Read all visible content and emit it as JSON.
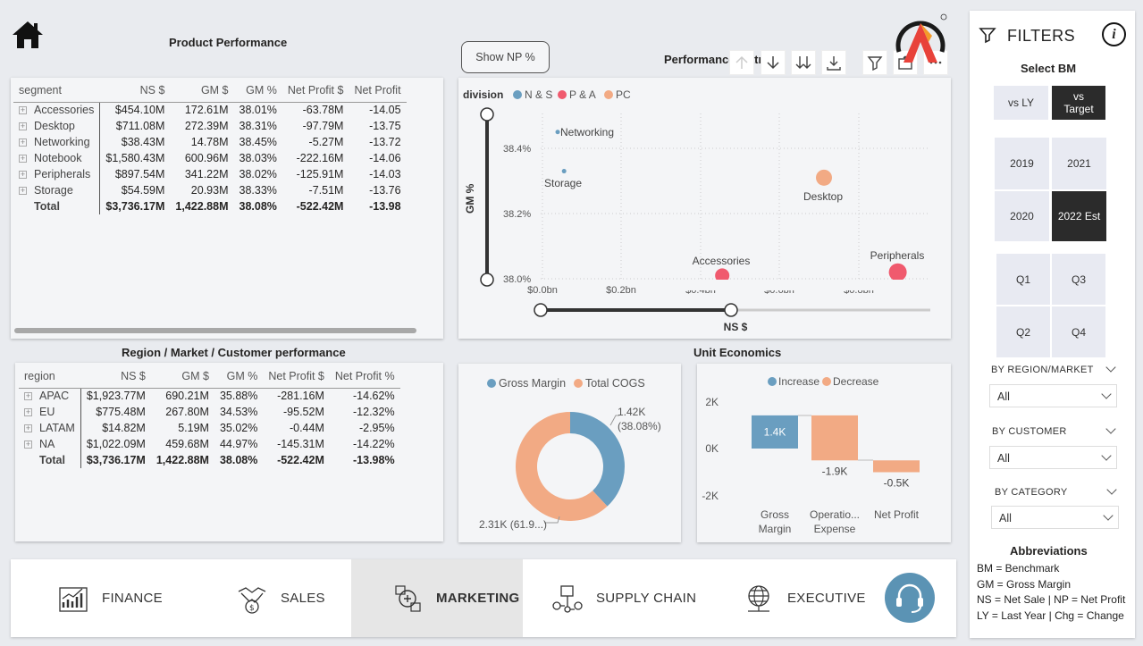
{
  "home_icon": "home-icon",
  "product_performance": {
    "title": "Product Performance",
    "columns": [
      "segment",
      "NS $",
      "GM $",
      "GM %",
      "Net Profit $",
      "Net Profit"
    ],
    "rows": [
      {
        "name": "Accessories",
        "ns": "$454.10M",
        "gm": "172.61M",
        "gmp": "38.01%",
        "np": "-63.78M",
        "npp": "-14.05"
      },
      {
        "name": "Desktop",
        "ns": "$711.08M",
        "gm": "272.39M",
        "gmp": "38.31%",
        "np": "-97.79M",
        "npp": "-13.75"
      },
      {
        "name": "Networking",
        "ns": "$38.43M",
        "gm": "14.78M",
        "gmp": "38.45%",
        "np": "-5.27M",
        "npp": "-13.72"
      },
      {
        "name": "Notebook",
        "ns": "$1,580.43M",
        "gm": "600.96M",
        "gmp": "38.03%",
        "np": "-222.16M",
        "npp": "-14.06"
      },
      {
        "name": "Peripherals",
        "ns": "$897.54M",
        "gm": "341.22M",
        "gmp": "38.02%",
        "np": "-125.91M",
        "npp": "-14.03"
      },
      {
        "name": "Storage",
        "ns": "$54.59M",
        "gm": "20.93M",
        "gmp": "38.33%",
        "np": "-7.51M",
        "npp": "-13.76"
      }
    ],
    "total": {
      "name": "Total",
      "ns": "$3,736.17M",
      "gm": "1,422.88M",
      "gmp": "38.08%",
      "np": "-522.42M",
      "npp": "-13.98"
    }
  },
  "show_np_button": "Show NP %",
  "performance_title": "Performance Matrix",
  "scatter": {
    "legend_title": "division",
    "legend": [
      {
        "name": "N & S",
        "color": "#6a9ec0"
      },
      {
        "name": "P & A",
        "color": "#f05a6e"
      },
      {
        "name": "PC",
        "color": "#f2aa84"
      }
    ],
    "ylabel": "GM %",
    "xlabel": "NS $",
    "y_ticks": [
      "38.4%",
      "38.2%",
      "38.0%"
    ],
    "x_ticks": [
      "$0.0bn",
      "$0.2bn",
      "$0.4bn",
      "$0.6bn",
      "$0.8bn"
    ]
  },
  "region_performance": {
    "title": "Region / Market / Customer performance",
    "columns": [
      "region",
      "NS $",
      "GM $",
      "GM %",
      "Net Profit $",
      "Net Profit %"
    ],
    "rows": [
      {
        "name": "APAC",
        "ns": "$1,923.77M",
        "gm": "690.21M",
        "gmp": "35.88%",
        "np": "-281.16M",
        "npp": "-14.62%"
      },
      {
        "name": "EU",
        "ns": "$775.48M",
        "gm": "267.80M",
        "gmp": "34.53%",
        "np": "-95.52M",
        "npp": "-12.32%"
      },
      {
        "name": "LATAM",
        "ns": "$14.82M",
        "gm": "5.19M",
        "gmp": "35.02%",
        "np": "-0.44M",
        "npp": "-2.95%"
      },
      {
        "name": "NA",
        "ns": "$1,022.09M",
        "gm": "459.68M",
        "gmp": "44.97%",
        "np": "-145.31M",
        "npp": "-14.22%"
      }
    ],
    "total": {
      "name": "Total",
      "ns": "$3,736.17M",
      "gm": "1,422.88M",
      "gmp": "38.08%",
      "np": "-522.42M",
      "npp": "-13.98%"
    }
  },
  "donut": {
    "legend": [
      {
        "name": "Gross Margin",
        "color": "#6a9ec0"
      },
      {
        "name": "Total COGS",
        "color": "#f2aa84"
      }
    ],
    "label_gm_line1": "1.42K",
    "label_gm_line2": "(38.08%)",
    "label_cogs": "2.31K (61.9...)"
  },
  "unit_economics": {
    "title": "Unit Economics",
    "legend": [
      {
        "name": "Increase",
        "color": "#6a9ec0"
      },
      {
        "name": "Decrease",
        "color": "#f2aa84"
      }
    ],
    "y_ticks": [
      "2K",
      "0K",
      "-2K"
    ],
    "bars": [
      {
        "label": "1.4K",
        "cat1": "Gross",
        "cat2": "Margin"
      },
      {
        "label": "-1.9K",
        "cat1": "Operatio...",
        "cat2": "Expense"
      },
      {
        "label": "-0.5K",
        "cat1": "Net Profit",
        "cat2": ""
      }
    ]
  },
  "filters": {
    "title": "FILTERS",
    "select_bm": "Select BM",
    "bm_options": [
      "vs LY",
      "vs Target"
    ],
    "years": [
      "2019",
      "2021",
      "2020",
      "2022 Est"
    ],
    "quarters": [
      "Q1",
      "Q3",
      "Q2",
      "Q4"
    ],
    "dropdowns": [
      {
        "label": "BY REGION/MARKET",
        "value": "All"
      },
      {
        "label": "BY CUSTOMER",
        "value": "All"
      },
      {
        "label": "BY CATEGORY",
        "value": "All"
      }
    ],
    "abbr_title": "Abbreviations",
    "abbr_lines": [
      "BM = Benchmark",
      "GM = Gross Margin",
      "NS = Net Sale | NP = Net Profit",
      "LY = Last Year | Chg = Change"
    ]
  },
  "nav": [
    {
      "label": "FINANCE",
      "icon": "finance-chart-icon"
    },
    {
      "label": "SALES",
      "icon": "sales-handshake-icon"
    },
    {
      "label": "MARKETING",
      "icon": "marketing-icon"
    },
    {
      "label": "SUPPLY CHAIN",
      "icon": "supply-chain-icon"
    },
    {
      "label": "EXECUTIVE",
      "icon": "executive-globe-icon"
    }
  ]
}
